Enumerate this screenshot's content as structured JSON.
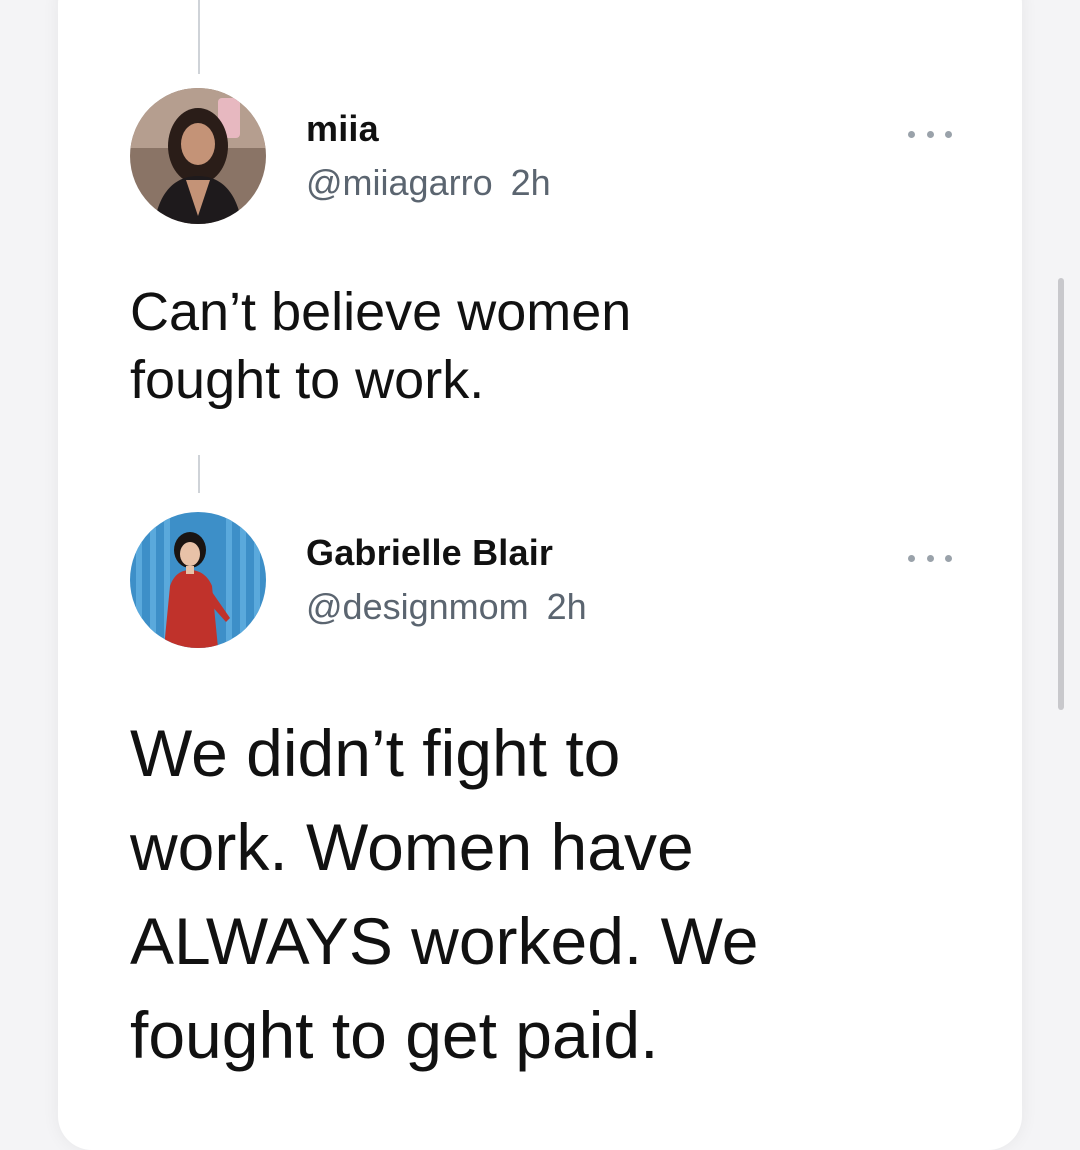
{
  "thread": [
    {
      "display_name": "miia",
      "handle": "@miiagarro",
      "time": "2h",
      "avatar_icon": "profile-photo",
      "text_lines": [
        "Can’t believe women",
        "fought to work."
      ]
    },
    {
      "display_name": "Gabrielle Blair",
      "handle": "@designmom",
      "time": "2h",
      "avatar_icon": "profile-photo",
      "text_lines": [
        "We didn’t fight to",
        "work. Women have",
        "ALWAYS worked. We",
        "fought to get paid."
      ]
    }
  ],
  "colors": {
    "text": "#111111",
    "secondary_text": "#5b6570",
    "thread_line": "#cfd3d8",
    "background": "#ffffff"
  }
}
